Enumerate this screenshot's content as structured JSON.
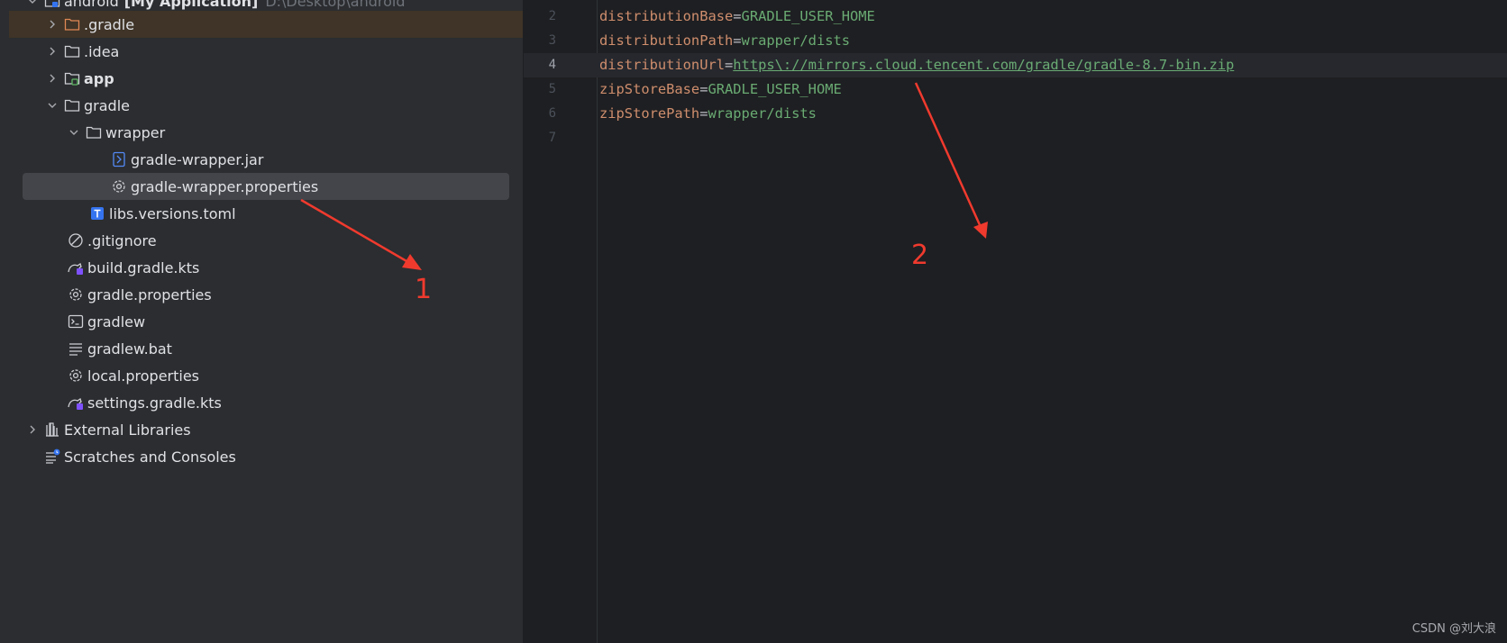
{
  "project_tree": {
    "root": {
      "name": "android",
      "module": "[My Application]",
      "path": "D:\\Desktop\\android"
    },
    "items": [
      {
        "label": ".gradle",
        "icon": "folder-orange-icon"
      },
      {
        "label": ".idea",
        "icon": "folder-icon"
      },
      {
        "label": "app",
        "icon": "module-folder-icon"
      },
      {
        "label": "gradle",
        "icon": "folder-icon"
      },
      {
        "label": "wrapper",
        "icon": "folder-icon"
      },
      {
        "label": "gradle-wrapper.jar",
        "icon": "jar-icon"
      },
      {
        "label": "gradle-wrapper.properties",
        "icon": "settings-gear-icon"
      },
      {
        "label": "libs.versions.toml",
        "icon": "toml-icon"
      },
      {
        "label": ".gitignore",
        "icon": "ignore-icon"
      },
      {
        "label": "build.gradle.kts",
        "icon": "gradle-kts-icon"
      },
      {
        "label": "gradle.properties",
        "icon": "settings-gear-icon"
      },
      {
        "label": "gradlew",
        "icon": "terminal-icon"
      },
      {
        "label": "gradlew.bat",
        "icon": "text-lines-icon"
      },
      {
        "label": "local.properties",
        "icon": "settings-gear-icon"
      },
      {
        "label": "settings.gradle.kts",
        "icon": "gradle-kts-icon"
      },
      {
        "label": "External Libraries",
        "icon": "library-icon"
      },
      {
        "label": "Scratches and Consoles",
        "icon": "scratches-icon"
      }
    ]
  },
  "editor": {
    "lines": [
      {
        "number": "2",
        "key": "distributionBase",
        "value": "GRADLE_USER_HOME"
      },
      {
        "number": "3",
        "key": "distributionPath",
        "value": "wrapper/dists"
      },
      {
        "number": "4",
        "key": "distributionUrl",
        "value": "https\\://mirrors.cloud.tencent.com/gradle/gradle-8.7-bin.zip"
      },
      {
        "number": "5",
        "key": "zipStoreBase",
        "value": "GRADLE_USER_HOME"
      },
      {
        "number": "6",
        "key": "zipStorePath",
        "value": "wrapper/dists"
      },
      {
        "number": "7",
        "key": "",
        "value": ""
      }
    ],
    "current_line": "4"
  },
  "annotations": {
    "arrow1_label": "1",
    "arrow2_label": "2",
    "color": "#f03a2e"
  },
  "watermark": "CSDN @刘大浪",
  "colors": {
    "key": "#cf8e6d",
    "value": "#6aab73",
    "panel": "#2b2d30",
    "editor": "#1e1f22"
  }
}
